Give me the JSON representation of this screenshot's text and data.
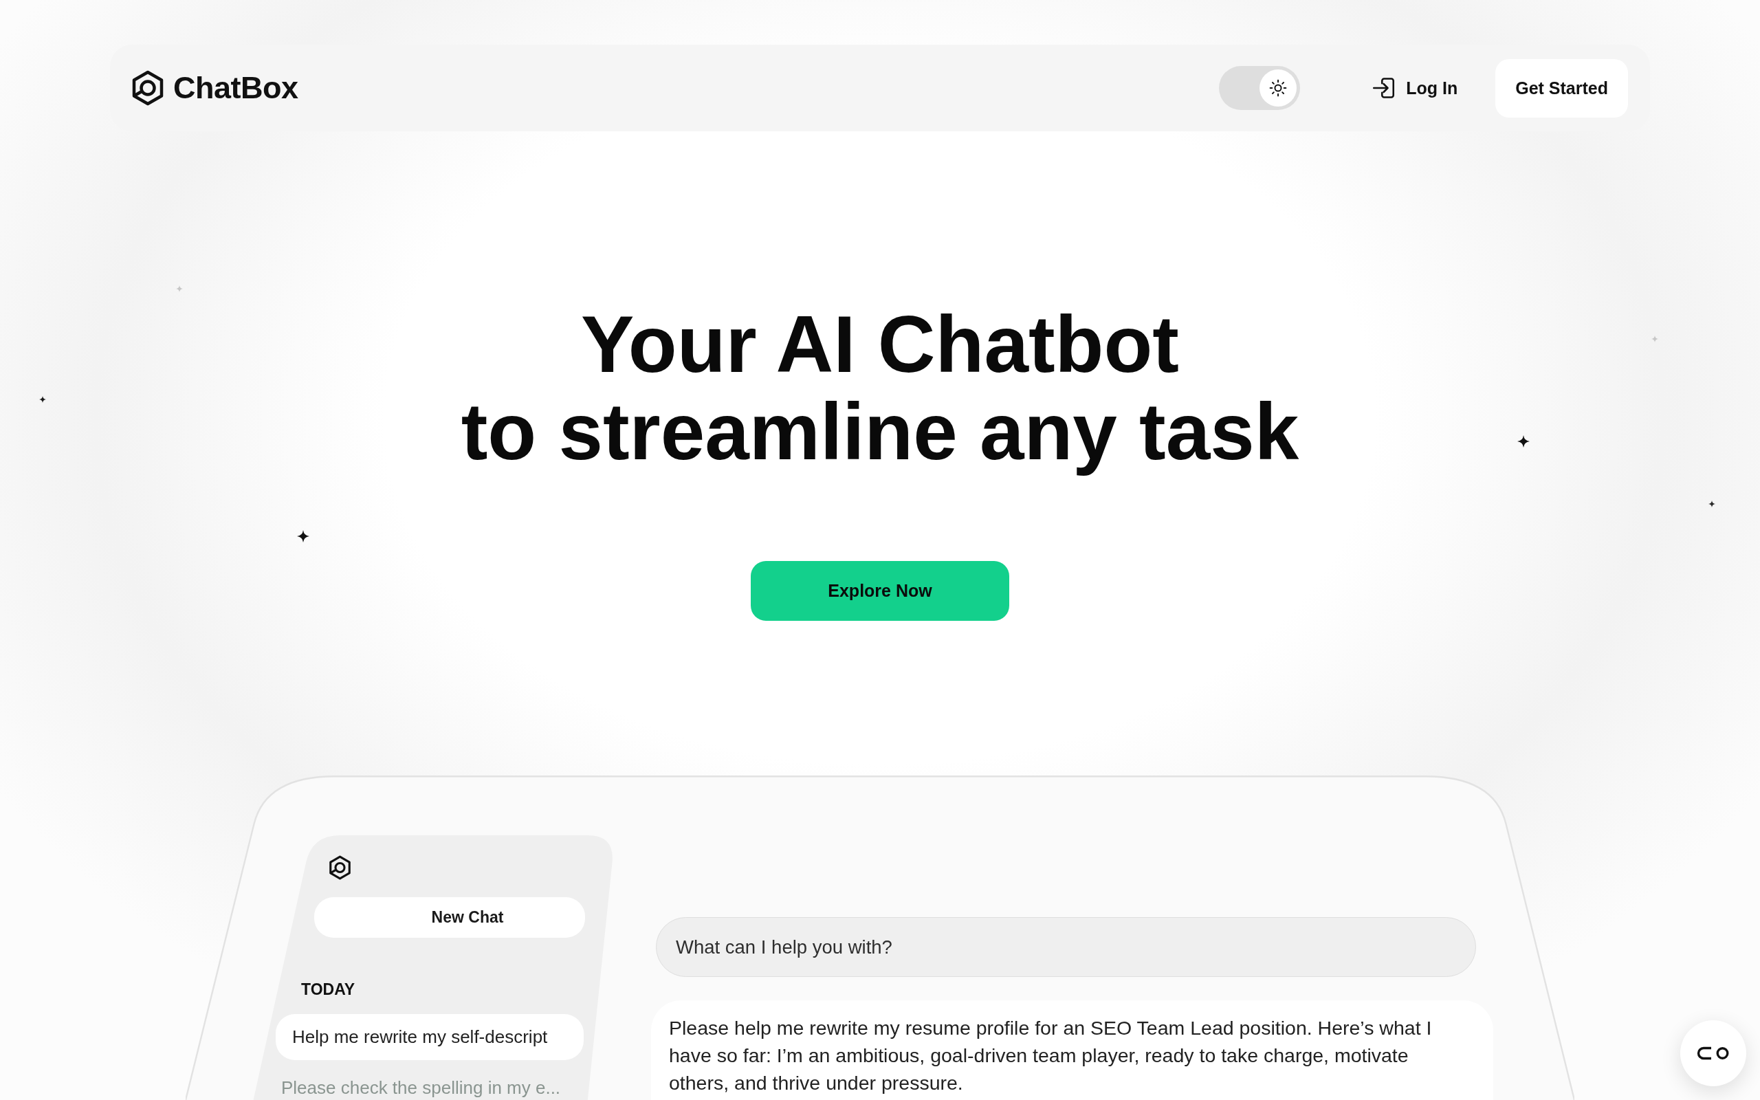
{
  "nav": {
    "brand": "ChatBox",
    "theme_toggle": {
      "on": true
    },
    "login": "Log In",
    "cta": "Get Started"
  },
  "hero": {
    "title_lines": [
      "Your AI Chatbot",
      "to streamline any task"
    ],
    "button": "Explore Now"
  },
  "preview": {
    "sidebar": {
      "new_chat": "New Chat",
      "section": "TODAY",
      "chats": [
        {
          "title": "Help me rewrite my self-descript",
          "selected": true
        },
        {
          "title": "Please check the spelling in my e...",
          "selected": false
        }
      ]
    },
    "prompt": {
      "placeholder": "What can I help you with?"
    },
    "message": {
      "text": "Please help me rewrite my resume profile for an SEO Team Lead position. Here’s what I have so far: I’m an ambitious, goal-driven team player, ready to take charge, motivate others, and thrive under pressure."
    }
  }
}
